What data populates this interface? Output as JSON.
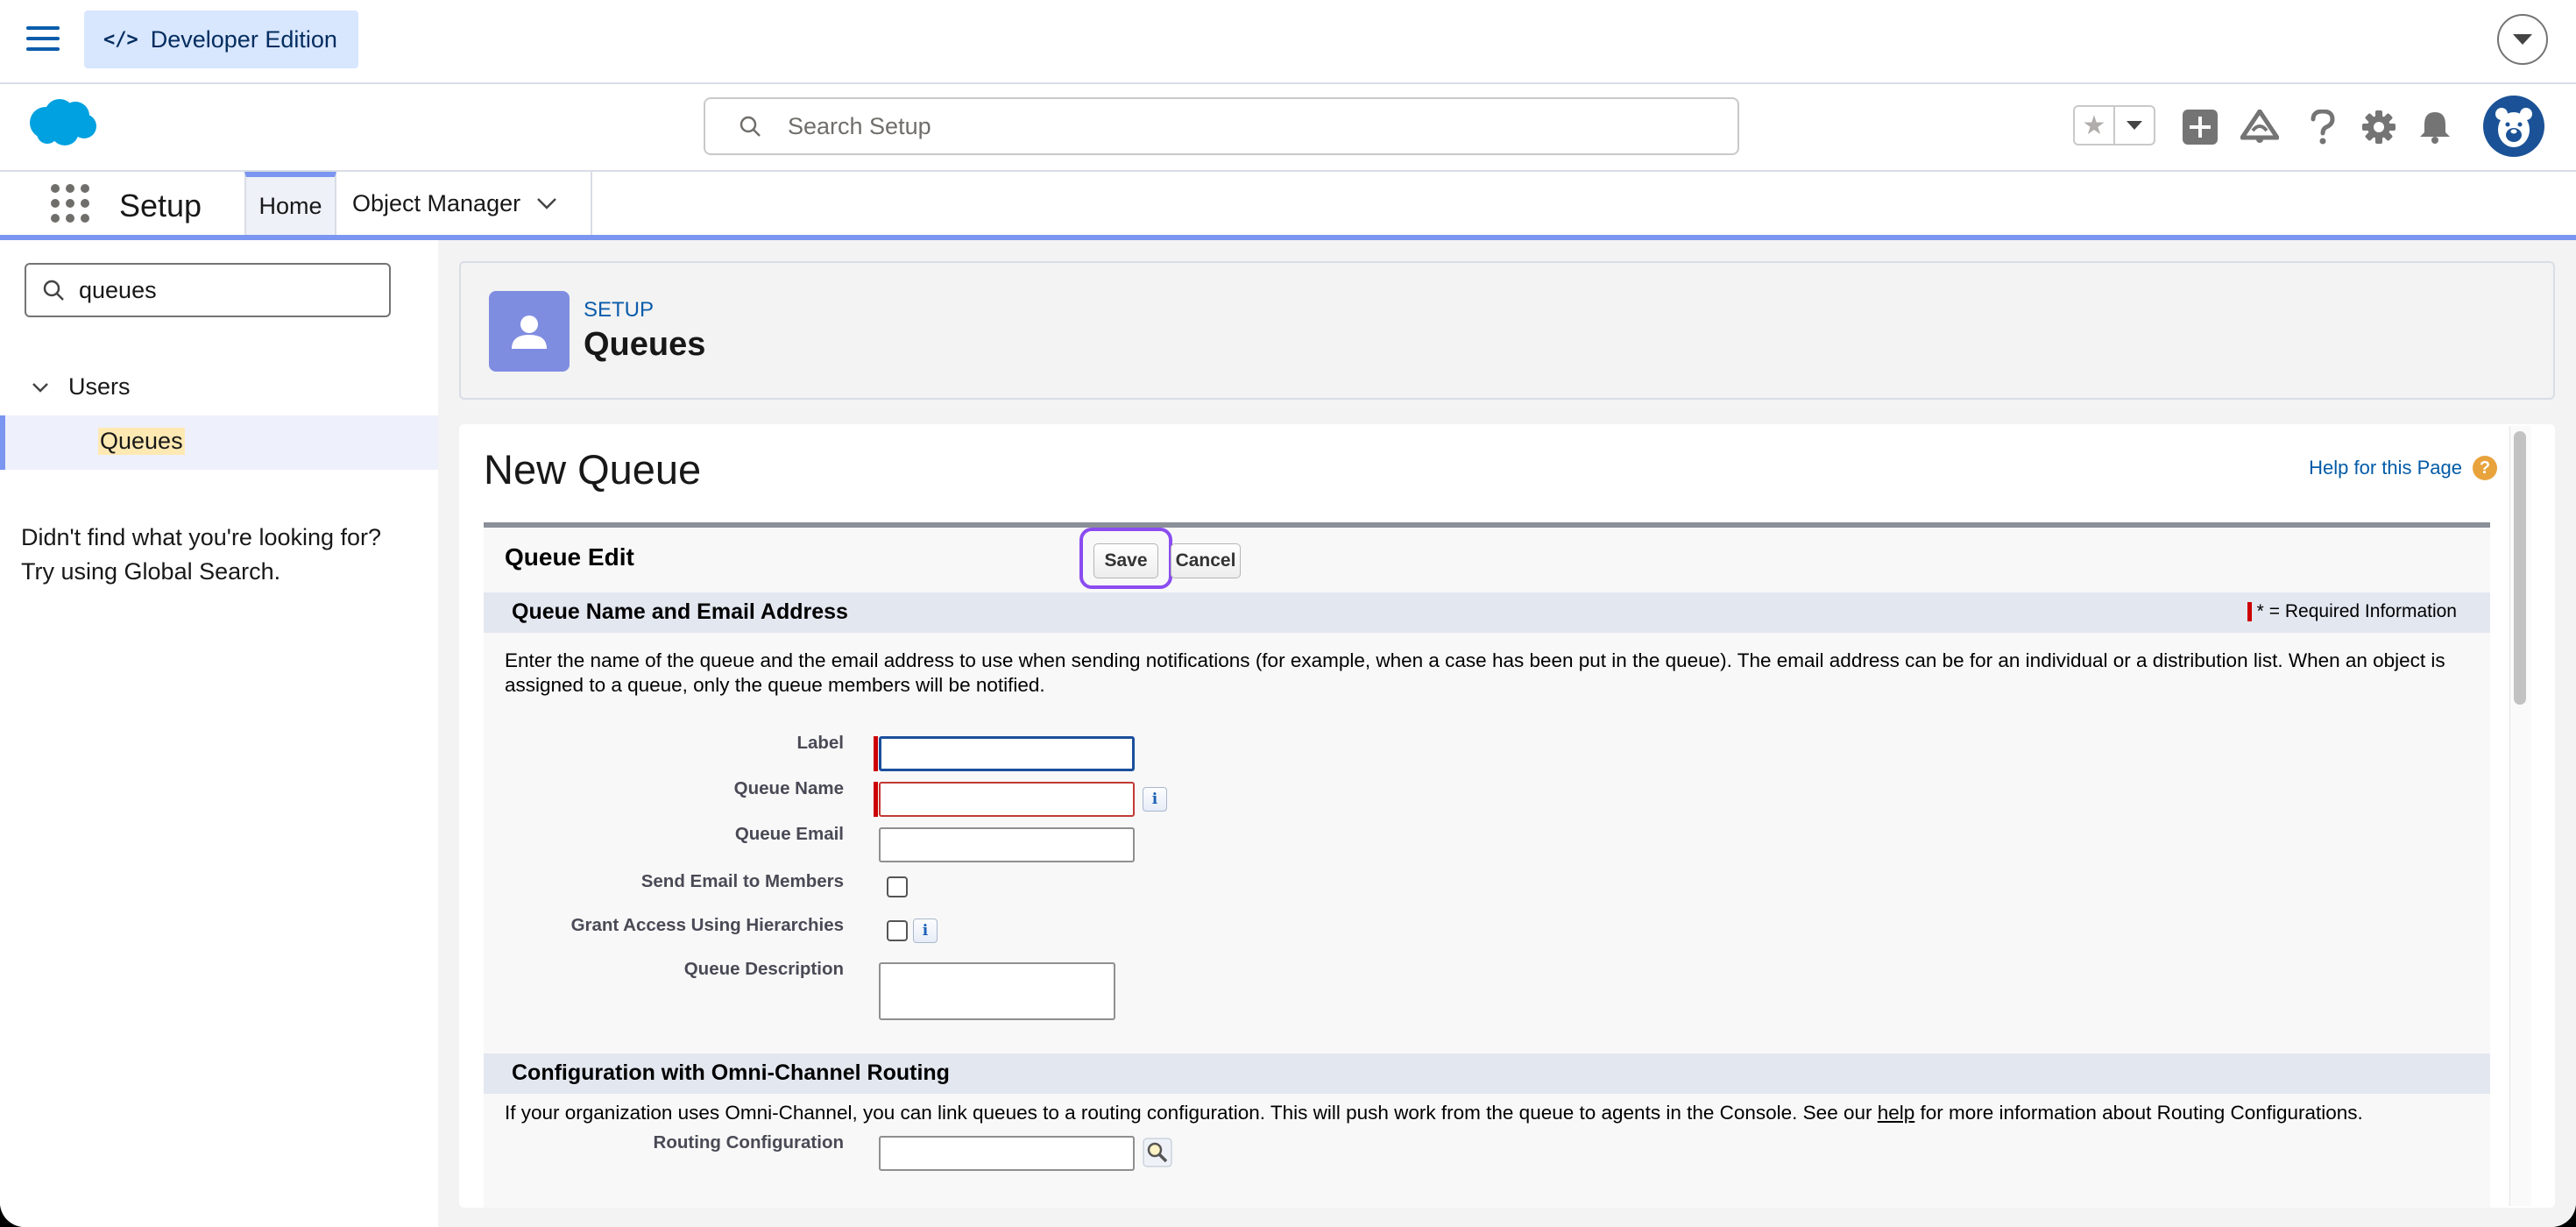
{
  "header": {
    "edition_label": "Developer Edition",
    "search_placeholder": "Search Setup"
  },
  "nav": {
    "app_name": "Setup",
    "tabs": [
      {
        "label": "Home",
        "active": true
      },
      {
        "label": "Object Manager"
      }
    ]
  },
  "sidebar": {
    "quick_find_value": "queues",
    "group_label": "Users",
    "item_label": "Queues",
    "not_found_line1": "Didn't find what you're looking for?",
    "not_found_line2": "Try using Global Search."
  },
  "page_header": {
    "eyebrow": "SETUP",
    "title": "Queues"
  },
  "content": {
    "page_title": "New Queue",
    "help_link": "Help for this Page",
    "form_title": "Queue Edit",
    "save_label": "Save",
    "cancel_label": "Cancel",
    "section1_title": "Queue Name and Email Address",
    "required_legend": "= Required Information",
    "section1_desc": "Enter the name of the queue and the email address to use when sending notifications (for example, when a case has been put in the queue). The email address can be for an individual or a distribution list. When an object is assigned to a queue, only the queue members will be notified.",
    "fields": {
      "label": "Label",
      "queue_name": "Queue Name",
      "queue_email": "Queue Email",
      "send_email": "Send Email to Members",
      "grant_access": "Grant Access Using Hierarchies",
      "queue_description": "Queue Description"
    },
    "section2_title": "Configuration with Omni-Channel Routing",
    "section2_desc_pre": "If your organization uses Omni-Channel, you can link queues to a routing configuration. This will push work from the queue to agents in the Console. See our ",
    "section2_desc_link": "help",
    "section2_desc_post": " for more information about Routing Configurations.",
    "routing_config_label": "Routing Configuration"
  },
  "colors": {
    "brand_blue": "#0b5cab",
    "accent_purple": "#8a4cf0",
    "nav_accent": "#7b96f0",
    "required_red": "#c00"
  }
}
